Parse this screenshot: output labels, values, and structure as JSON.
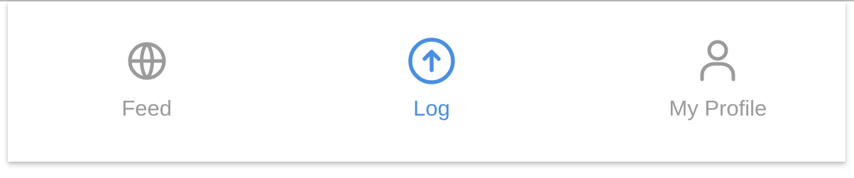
{
  "theme": {
    "active_color": "#4a8fe0",
    "inactive_color": "#9b9b9b",
    "bar_background": "#ffffff"
  },
  "tab_bar": {
    "tabs": [
      {
        "label": "Feed",
        "icon": "globe-icon",
        "active": false
      },
      {
        "label": "Log",
        "icon": "arrow-up-circle-icon",
        "active": true
      },
      {
        "label": "My Profile",
        "icon": "user-icon",
        "active": false
      }
    ]
  }
}
